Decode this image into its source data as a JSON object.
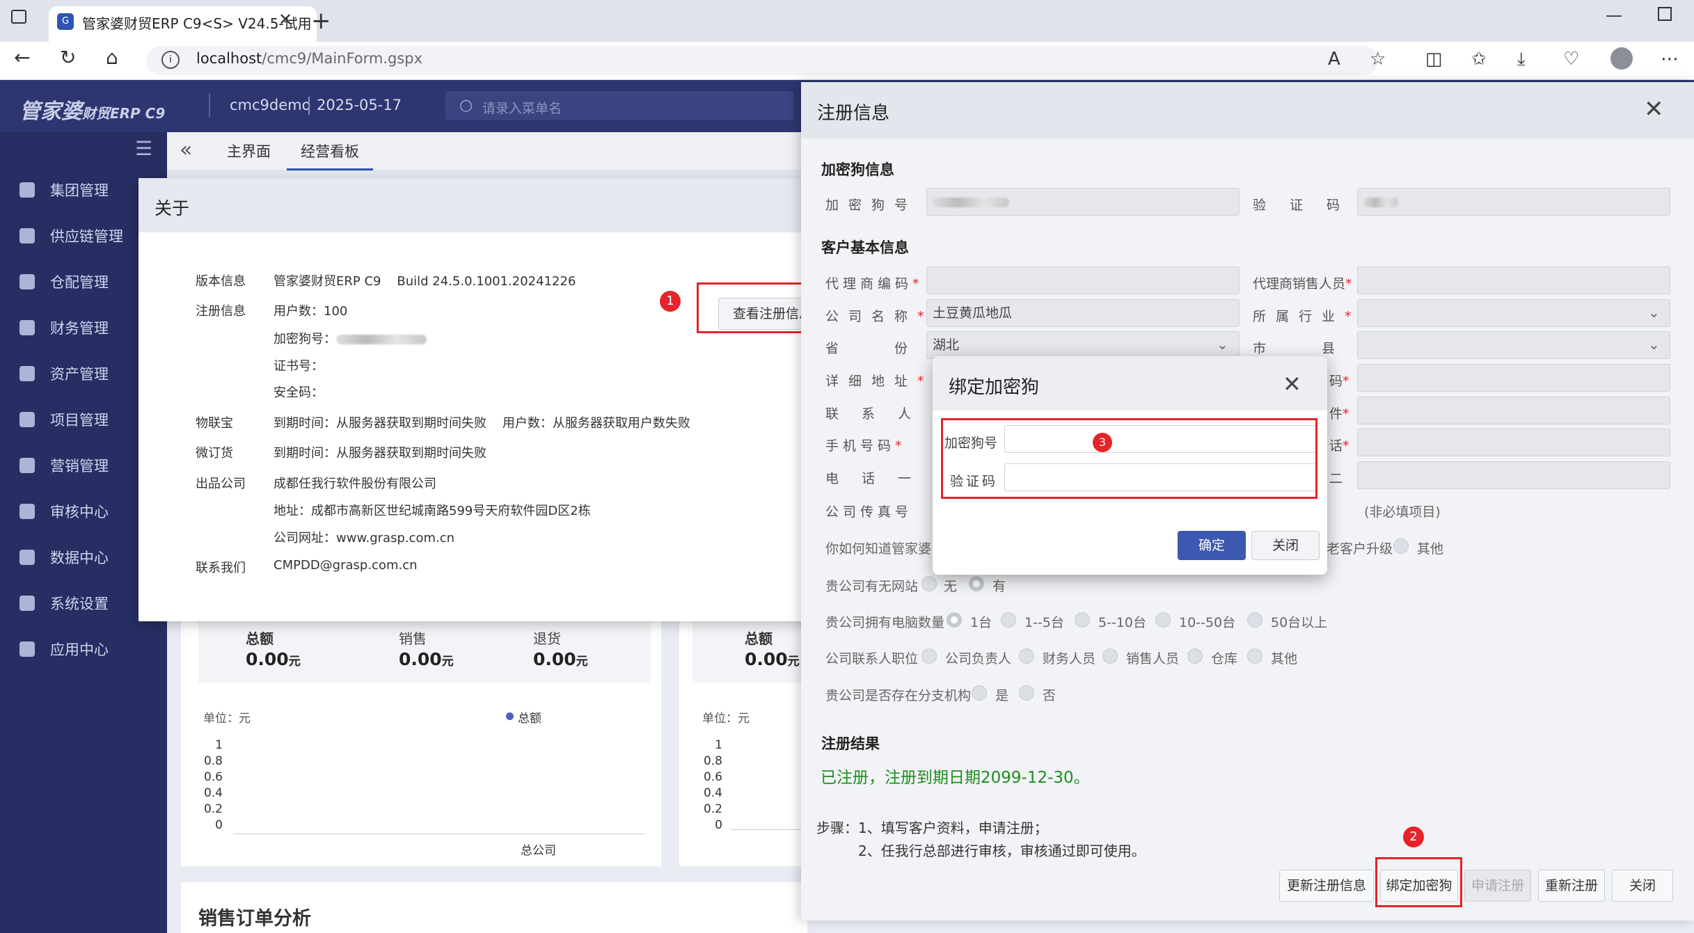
{
  "browser": {
    "tab_title": "管家婆财贸ERP C9<S> V24.5-试用",
    "url_host": "localhost",
    "url_path": "/cmc9/MainForm.gspx"
  },
  "app": {
    "logo": "管家婆",
    "logo_sub": "财贸ERP C9",
    "user": "cmc9demo",
    "date": "2025-05-17",
    "search_placeholder": "请录入菜单名"
  },
  "sidebar": {
    "items": [
      {
        "label": "集团管理",
        "icon": "layers-icon"
      },
      {
        "label": "供应链管理",
        "icon": "supply-chain-icon"
      },
      {
        "label": "仓配管理",
        "icon": "warehouse-icon"
      },
      {
        "label": "财务管理",
        "icon": "money-bag-icon"
      },
      {
        "label": "资产管理",
        "icon": "briefcase-icon"
      },
      {
        "label": "项目管理",
        "icon": "project-icon"
      },
      {
        "label": "营销管理",
        "icon": "folder-icon"
      },
      {
        "label": "审核中心",
        "icon": "audit-icon"
      },
      {
        "label": "数据中心",
        "icon": "chart-icon"
      },
      {
        "label": "系统设置",
        "icon": "gear-icon"
      },
      {
        "label": "应用中心",
        "icon": "apps-icon"
      }
    ]
  },
  "tabs": [
    "主界面",
    "经营看板"
  ],
  "dashboard": {
    "card1": {
      "total_label": "总额",
      "total": "0.00",
      "sales_label": "销售",
      "sales": "0.00",
      "return_label": "退货",
      "return": "0.00",
      "unit_suffix": "元",
      "unit": "单位：元",
      "legend": "总额",
      "xlabel": "总公司",
      "yticks": [
        "1",
        "0.8",
        "0.6",
        "0.4",
        "0.2",
        "0"
      ]
    },
    "card2": {
      "total_label": "总额",
      "total": "0.00",
      "unit_suffix": "元",
      "unit": "单位：元",
      "yticks": [
        "1",
        "0.8",
        "0.6",
        "0.4",
        "0.2",
        "0"
      ]
    },
    "bottom_title": "销售订单分析"
  },
  "about": {
    "title": "关于",
    "version_label": "版本信息",
    "version_value": "管家婆财贸ERP C9    Build 24.5.0.1001.20241226",
    "reg_label": "注册信息",
    "users": "用户数：100",
    "dongle_label": "加密狗号：",
    "cert_label": "证书号：",
    "security_label": "安全码：",
    "iot_label": "物联宝",
    "iot_value": "到期时间：从服务器获取到期时间失败    用户数：从服务器获取用户数失败",
    "micro_label": "微订货",
    "micro_value": "到期时间：从服务器获取到期时间失败",
    "company_label": "出品公司",
    "company_value": "成都任我行软件股份有限公司",
    "address": "地址：成都市高新区世纪城南路599号天府软件园D区2栋",
    "website": "公司网址：www.grasp.com.cn",
    "contact_label": "联系我们",
    "contact_value": "CMPDD@grasp.com.cn",
    "view_button": "查看注册信息"
  },
  "reg": {
    "title": "注册信息",
    "dongle_section": "加密狗信息",
    "dongle_no_label": "加密狗号",
    "verify_label": "验证码",
    "customer_section": "客户基本信息",
    "agent_code_label": "代理商编码",
    "agent_sales_label": "代理商销售人员",
    "company_name_label": "公司名称",
    "company_name_value": "土豆黄瓜地瓜",
    "industry_label": "所属行业",
    "province_label": "省份",
    "province_value": "湖北",
    "city_label": "市县",
    "address_label": "详细地址",
    "postcode_suffix": "码",
    "contact_label": "联系人",
    "email_suffix": "件",
    "mobile_label": "手机号码",
    "phone_suffix": "话",
    "phone1_label": "电话一",
    "phone2_suffix": "二",
    "fax_label": "公司传真号",
    "optional_note": "(非必填项目)",
    "source_label": "你如何知道管家婆",
    "source_opt1": "老客户升级",
    "source_opt2": "其他",
    "website_q": "贵公司有无网站",
    "website_no": "无",
    "website_yes": "有",
    "pc_q": "贵公司拥有电脑数量",
    "pc_opts": [
      "1台",
      "1--5台",
      "5--10台",
      "10--50台",
      "50台以上"
    ],
    "role_q": "公司联系人职位",
    "role_opts": [
      "公司负责人",
      "财务人员",
      "销售人员",
      "仓库",
      "其他"
    ],
    "branch_q": "贵公司是否存在分支机构",
    "branch_yes": "是",
    "branch_no": "否",
    "result_section": "注册结果",
    "result_text": "已注册，注册到期日期2099-12-30。",
    "step1": "步骤：1、填写客户资料，申请注册；",
    "step2": "2、任我行总部进行审核，审核通过即可使用。",
    "btn_update": "更新注册信息",
    "btn_bind": "绑定加密狗",
    "btn_apply": "申请注册",
    "btn_reregister": "重新注册",
    "btn_close": "关闭"
  },
  "bind": {
    "title": "绑定加密狗",
    "dongle_label": "加密狗号",
    "verify_label": "验证码",
    "ok": "确定",
    "close": "关闭"
  },
  "badges": [
    "1",
    "2",
    "3"
  ],
  "colors": {
    "accent": "#2d55b4",
    "header": "#2d3670",
    "sidebar": "#272e63",
    "annotation": "#e5232b",
    "success": "#1d8d1d"
  }
}
